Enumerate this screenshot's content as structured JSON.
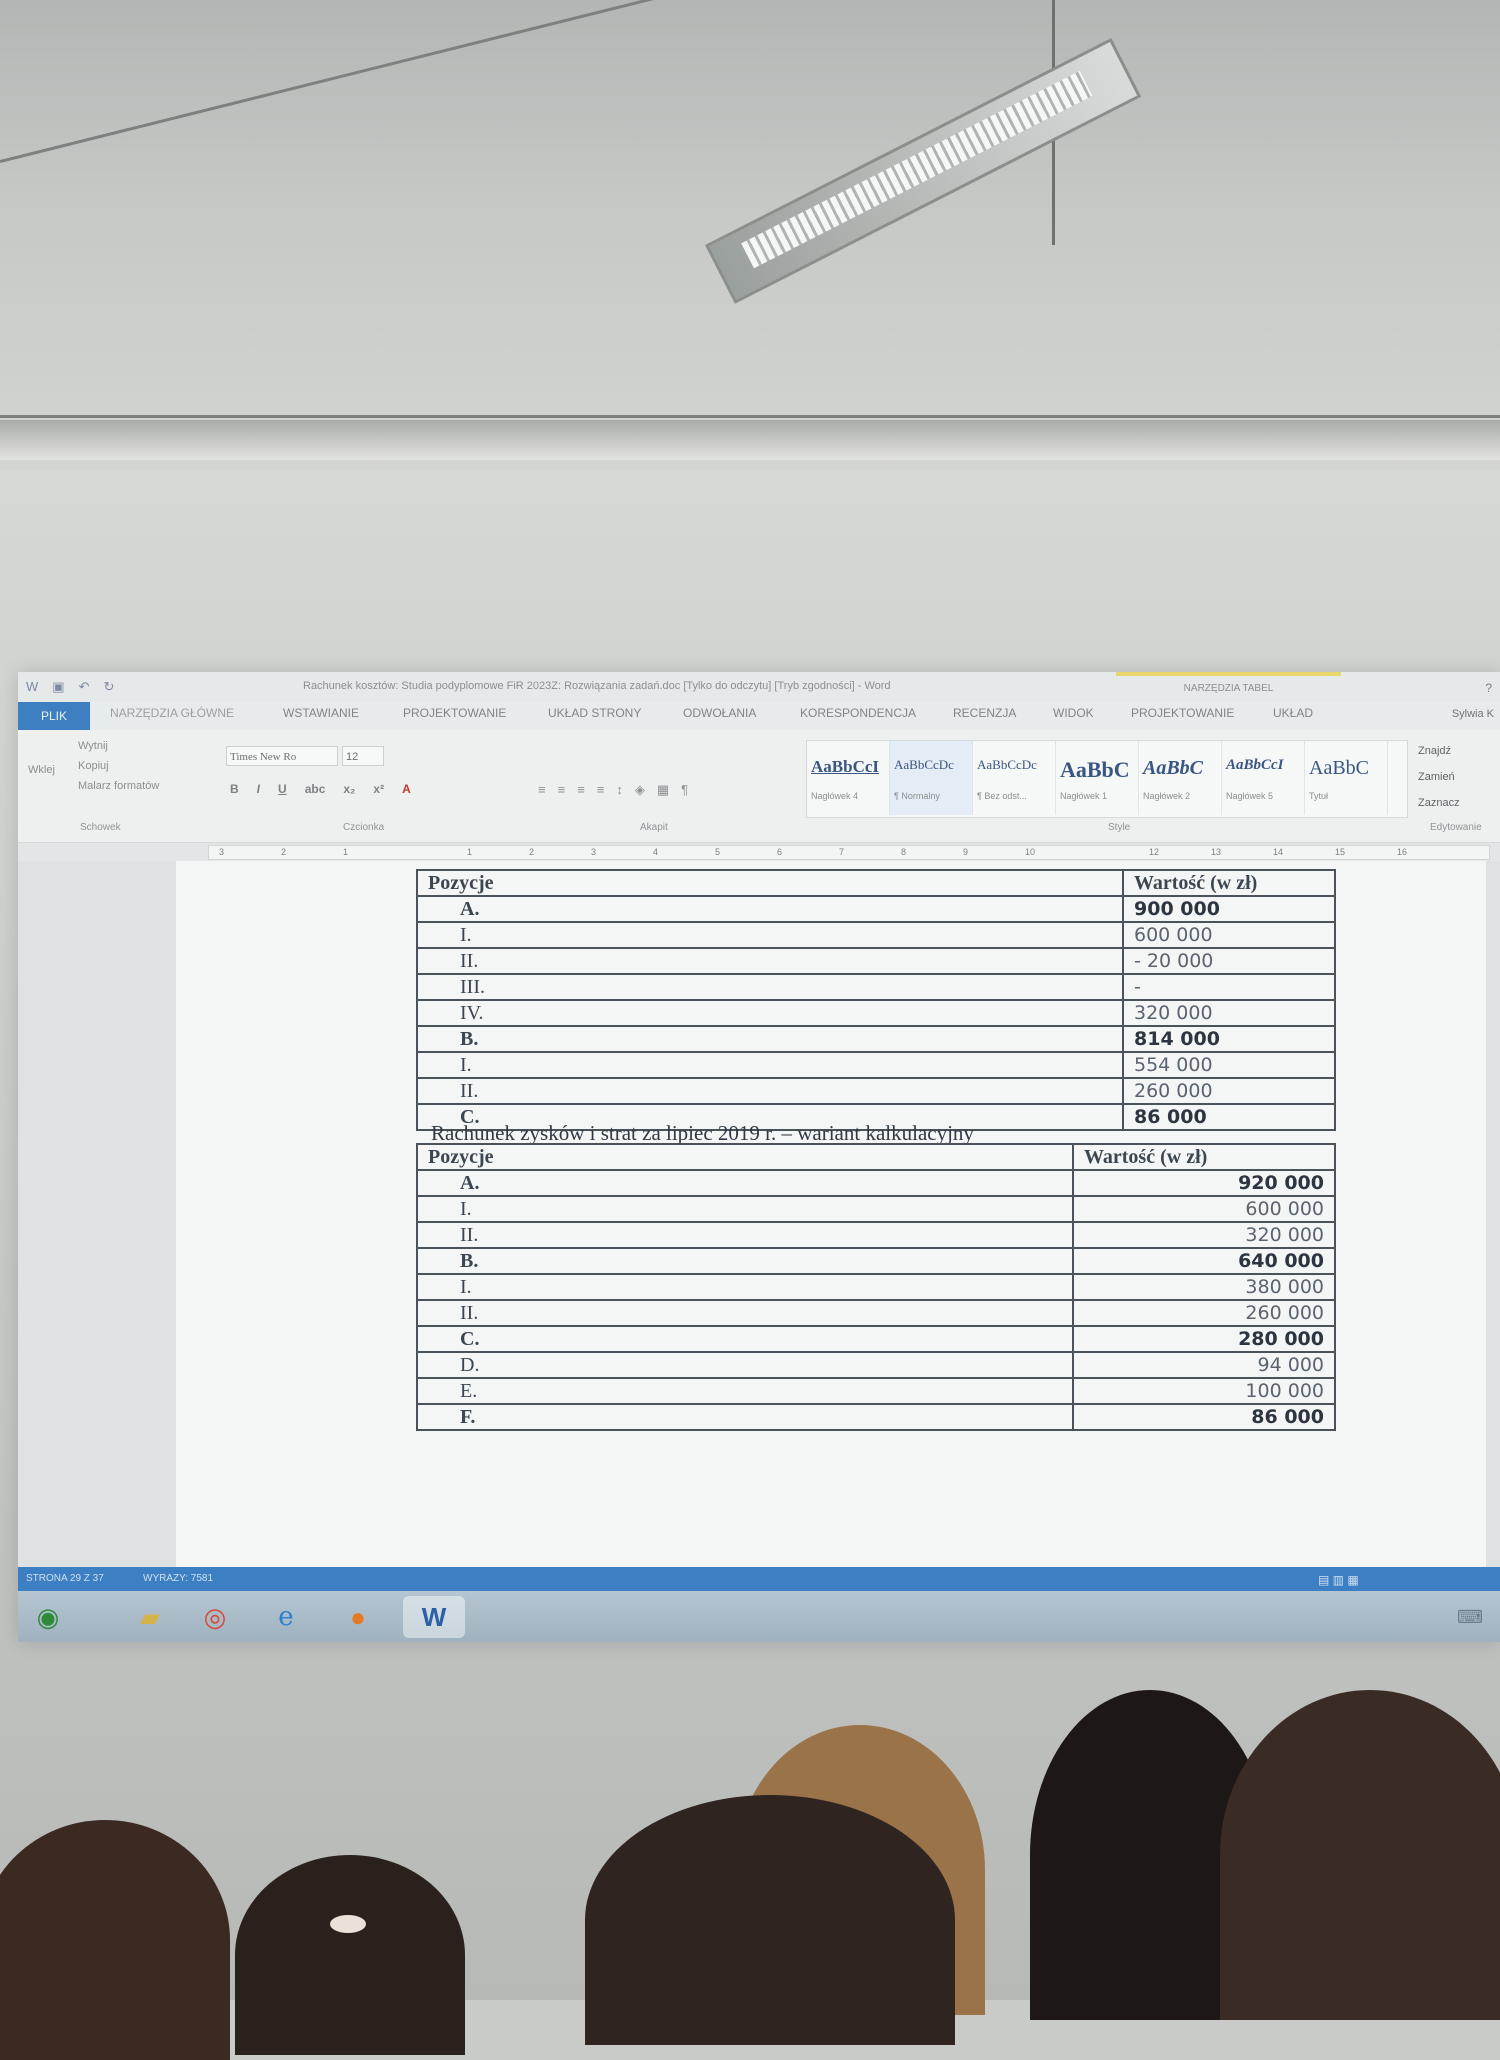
{
  "window": {
    "title": "Rachunek kosztów: Studia podyplomowe FiR 2023Z: Rozwiązania zadań.doc [Tylko do odczytu] [Tryb zgodności] - Word",
    "context_tools": "NARZĘDZIA TABEL",
    "controls": "?"
  },
  "tabs": [
    "PLIK",
    "NARZĘDZIA GŁÓWNE",
    "WSTAWIANIE",
    "PROJEKTOWANIE",
    "UKŁAD STRONY",
    "ODWOŁANIA",
    "KORESPONDENCJA",
    "RECENZJA",
    "WIDOK",
    "PROJEKTOWANIE",
    "UKŁAD"
  ],
  "user": "Sylwia K",
  "ribbon": {
    "clipboard": {
      "paste": "Wklej",
      "cut": "Wytnij",
      "copy": "Kopiuj",
      "format_painter": "Malarz formatów",
      "label": "Schowek"
    },
    "font": {
      "name": "Times New Ro",
      "size": "12",
      "label": "Czcionka"
    },
    "paragraph": {
      "label": "Akapit"
    },
    "styles": {
      "label": "Style",
      "items": [
        {
          "sample": "AaBbCcI",
          "name": "Nagłówek 4"
        },
        {
          "sample": "AaBbCcDc",
          "name": "¶ Normalny"
        },
        {
          "sample": "AaBbCcDc",
          "name": "¶ Bez odst..."
        },
        {
          "sample": "AaBbC",
          "name": "Nagłówek 1"
        },
        {
          "sample": "AaBbC",
          "name": "Nagłówek 2"
        },
        {
          "sample": "AaBbCcI",
          "name": "Nagłówek 5"
        },
        {
          "sample": "AaBbC",
          "name": "Tytuł"
        }
      ]
    },
    "editing": {
      "find": "Znajdź",
      "replace": "Zamień",
      "select": "Zaznacz",
      "label": "Edytowanie"
    }
  },
  "ruler": [
    "3",
    "2",
    "1",
    "1",
    "2",
    "3",
    "4",
    "5",
    "6",
    "7",
    "8",
    "9",
    "10",
    "12",
    "13",
    "14",
    "15",
    "16"
  ],
  "table1": {
    "header": {
      "left": "Pozycje",
      "right": "Wartość (w zł)"
    },
    "rows": [
      {
        "label": "A.",
        "value": "900 000",
        "bold": true
      },
      {
        "label": "I.",
        "value": "600 000"
      },
      {
        "label": "II.",
        "value": "- 20 000"
      },
      {
        "label": "III.",
        "value": "-"
      },
      {
        "label": "IV.",
        "value": "320 000"
      },
      {
        "label": "B.",
        "value": "814 000",
        "bold": true
      },
      {
        "label": "I.",
        "value": "554 000"
      },
      {
        "label": "II.",
        "value": "260 000"
      },
      {
        "label": "C.",
        "value": "86 000",
        "bold": true
      }
    ]
  },
  "table2": {
    "caption": "Rachunek zysków i strat za lipiec 2019 r. – wariant kalkulacyjny",
    "header": {
      "left": "Pozycje",
      "right": "Wartość (w zł)"
    },
    "rows": [
      {
        "label": "A.",
        "value": "920 000",
        "bold": true
      },
      {
        "label": "I.",
        "value": "600 000"
      },
      {
        "label": "II.",
        "value": "320 000"
      },
      {
        "label": "B.",
        "value": "640 000",
        "bold": true
      },
      {
        "label": "I.",
        "value": "380 000"
      },
      {
        "label": "II.",
        "value": "260 000"
      },
      {
        "label": "C.",
        "value": "280 000",
        "bold": true
      },
      {
        "label": "D.",
        "value": "94 000"
      },
      {
        "label": "E.",
        "value": "100 000"
      },
      {
        "label": "F.",
        "value": "86 000",
        "bold": true
      }
    ]
  },
  "status": {
    "page": "STRONA 29 Z 37",
    "words": "WYRAZY: 7581"
  },
  "taskbar": [
    "windows-start",
    "file-explorer",
    "chrome",
    "internet-explorer",
    "firefox",
    "word"
  ]
}
